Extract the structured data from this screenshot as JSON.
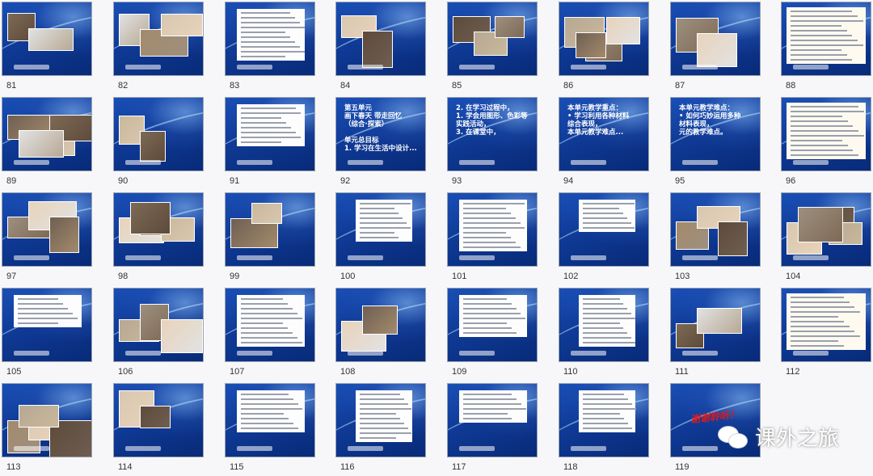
{
  "slides": [
    {
      "n": "81",
      "kind": "photos"
    },
    {
      "n": "82",
      "kind": "photos"
    },
    {
      "n": "83",
      "kind": "doc"
    },
    {
      "n": "84",
      "kind": "photos"
    },
    {
      "n": "85",
      "kind": "photos"
    },
    {
      "n": "86",
      "kind": "photos"
    },
    {
      "n": "87",
      "kind": "photos"
    },
    {
      "n": "88",
      "kind": "notepad"
    },
    {
      "n": "89",
      "kind": "photos"
    },
    {
      "n": "90",
      "kind": "photos"
    },
    {
      "n": "91",
      "kind": "doc"
    },
    {
      "n": "92",
      "kind": "title",
      "title": "第五单元\n画下春天  带走回忆\n（综合·探索）\n\n单元总目标\n1. 学习在生活中设计..."
    },
    {
      "n": "93",
      "kind": "title",
      "title": "2. 在学习过程中，\n1. 学会用图形、色彩等\n实践活动，\n3. 在课堂中，"
    },
    {
      "n": "94",
      "kind": "title",
      "title": "本单元教学重点：\n• 学习利用各种材料\n  综合表现，\n  本单元教学难点..."
    },
    {
      "n": "95",
      "kind": "title",
      "title": "本单元教学难点：\n• 如何巧妙运用多种\n  材料表现，\n  元的教学难点。"
    },
    {
      "n": "96",
      "kind": "notepad"
    },
    {
      "n": "97",
      "kind": "photos"
    },
    {
      "n": "98",
      "kind": "photos"
    },
    {
      "n": "99",
      "kind": "photos"
    },
    {
      "n": "100",
      "kind": "doc"
    },
    {
      "n": "101",
      "kind": "doc"
    },
    {
      "n": "102",
      "kind": "doc"
    },
    {
      "n": "103",
      "kind": "photos"
    },
    {
      "n": "104",
      "kind": "photos"
    },
    {
      "n": "105",
      "kind": "doc"
    },
    {
      "n": "106",
      "kind": "photos"
    },
    {
      "n": "107",
      "kind": "doc"
    },
    {
      "n": "108",
      "kind": "photos"
    },
    {
      "n": "109",
      "kind": "doc"
    },
    {
      "n": "110",
      "kind": "doc"
    },
    {
      "n": "111",
      "kind": "photos"
    },
    {
      "n": "112",
      "kind": "notepad"
    },
    {
      "n": "113",
      "kind": "photos"
    },
    {
      "n": "114",
      "kind": "photos"
    },
    {
      "n": "115",
      "kind": "doc"
    },
    {
      "n": "116",
      "kind": "doc"
    },
    {
      "n": "117",
      "kind": "doc"
    },
    {
      "n": "118",
      "kind": "doc"
    },
    {
      "n": "119",
      "kind": "title-red",
      "title": "谢谢聆听！"
    }
  ],
  "watermark": {
    "text": "课外之旅",
    "icon": "wechat-icon"
  },
  "colors": {
    "slide_bg": "#0f3a96",
    "page_bg": "#f7f7f9",
    "accent_red": "#e01818"
  }
}
